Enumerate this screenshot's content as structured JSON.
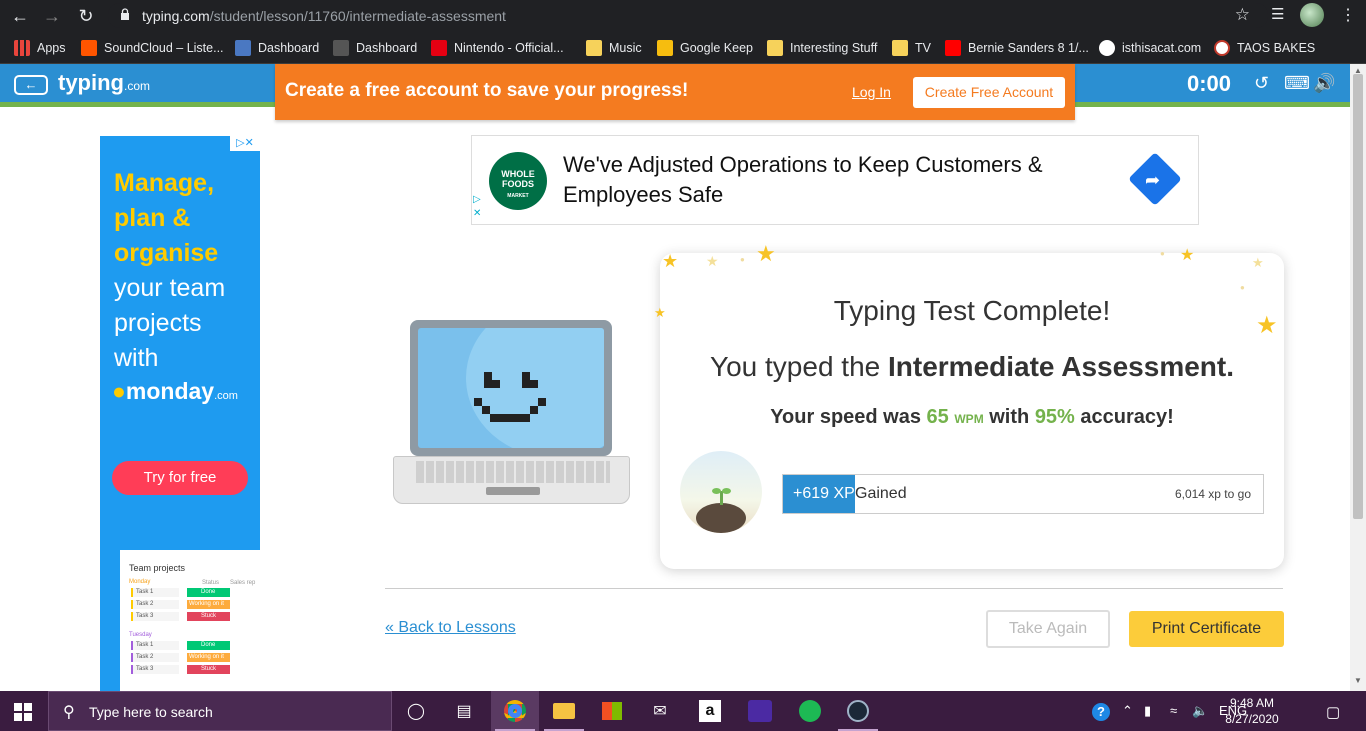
{
  "browser": {
    "url_host": "typing.com",
    "url_path": "/student/lesson/11760/intermediate-assessment",
    "bookmarks": [
      {
        "label": "Apps",
        "color": "#e8453c"
      },
      {
        "label": "SoundCloud – Liste...",
        "color": "#ff5500"
      },
      {
        "label": "Dashboard",
        "color": "#4a78c2"
      },
      {
        "label": "Dashboard",
        "color": "#333333"
      },
      {
        "label": "Nintendo - Official...",
        "color": "#e60012"
      },
      {
        "label": "Music",
        "color": "#f6d25b"
      },
      {
        "label": "Google Keep",
        "color": "#f6bd0f"
      },
      {
        "label": "Interesting Stuff",
        "color": "#f6d25b"
      },
      {
        "label": "TV",
        "color": "#f6d25b"
      },
      {
        "label": "Bernie Sanders 8 1/...",
        "color": "#ff0000"
      },
      {
        "label": "isthisacat.com",
        "color": "#ffffff"
      },
      {
        "label": "TAOS BAKES",
        "color": "#c0392b"
      }
    ]
  },
  "header": {
    "logo": "typing",
    "logo_suffix": ".com",
    "banner_text": "Create a free account to save your progress!",
    "login_label": "Log In",
    "create_account_label": "Create Free Account",
    "timer": "0:00"
  },
  "left_ad": {
    "line1": "Manage,",
    "line2": "plan &",
    "line3": "organise",
    "line4": "your team",
    "line5": "projects",
    "line6": "with",
    "brand": "monday",
    "brand_suffix": ".com",
    "cta": "Try for free",
    "table_title": "Team projects",
    "day1": "Monday",
    "day2": "Tuesday",
    "col_status": "Status",
    "col_sales": "Sales rep",
    "rows1": [
      "Task 1",
      "Task 2",
      "Task 3"
    ],
    "status1": [
      "Done",
      "Working on it",
      "Stuck"
    ],
    "rows2": [
      "Task 1",
      "Task 2",
      "Task 3"
    ],
    "status2": [
      "Done",
      "Working on it",
      "Stuck"
    ]
  },
  "top_ad": {
    "logo_line1": "WHOLE",
    "logo_line2": "FOODS",
    "logo_line3": "MARKET",
    "headline": "We've Adjusted Operations to Keep Customers & Employees Safe"
  },
  "result": {
    "title": "Typing Test Complete!",
    "sub_prefix": "You typed the",
    "lesson_name": "Intermediate Assessment.",
    "speed_prefix": "Your speed was",
    "wpm_value": "65",
    "wpm_unit": "WPM",
    "speed_middle": "with",
    "accuracy": "95%",
    "speed_suffix": "accuracy!",
    "xp_badge": "+619 XP",
    "xp_gained_label": "Gained",
    "xp_to_go": "6,014 xp to go",
    "xp_fill_percent": 15
  },
  "actions": {
    "back_label": "« Back to Lessons",
    "take_again_label": "Take Again",
    "print_label": "Print Certificate"
  },
  "taskbar": {
    "search_placeholder": "Type here to search",
    "language": "ENG",
    "time": "9:48 AM",
    "date": "8/27/2020"
  }
}
